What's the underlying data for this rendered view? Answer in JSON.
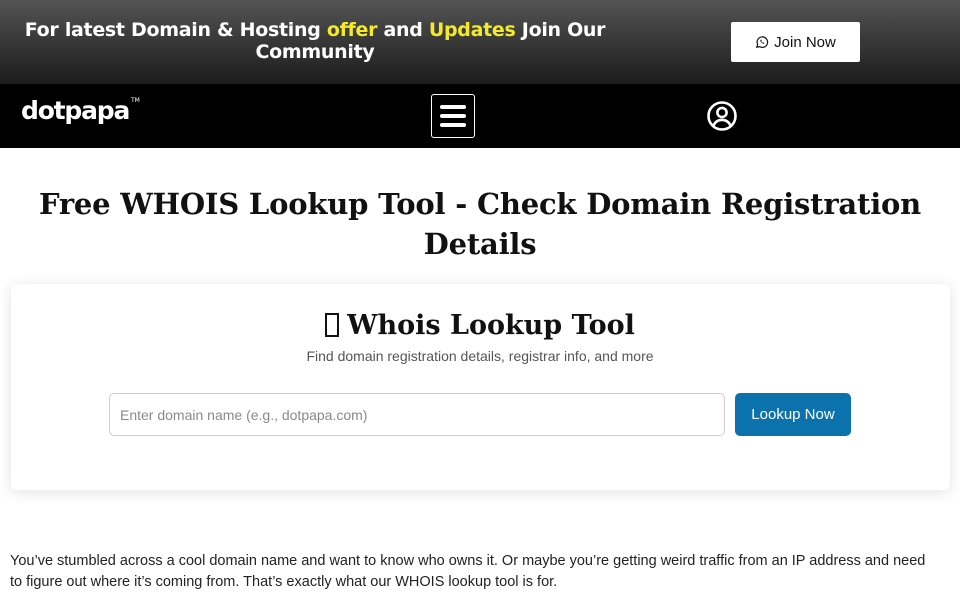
{
  "promo": {
    "text_before": "For latest Domain & Hosting ",
    "highlight_1": "offer",
    "text_middle": " and ",
    "highlight_2": "Updates",
    "text_after": " Join Our Community",
    "highlight_color": "#f5ea2a",
    "join_button": {
      "label": "Join Now",
      "icon": "whatsapp-icon"
    }
  },
  "nav": {
    "logo_text": "dotpapa",
    "logo_mark": "TM",
    "menu_icon": "hamburger-menu-icon",
    "account_icon": "user-circle-icon"
  },
  "page": {
    "title": "Free WHOIS Lookup Tool - Check Domain Registration Details"
  },
  "tool": {
    "title": "Whois Lookup Tool",
    "title_icon": "missing-glyph-icon",
    "subtitle": "Find domain registration details, registrar info, and more",
    "input": {
      "value": "",
      "placeholder": "Enter domain name (e.g., dotpapa.com)"
    },
    "button_label": "Lookup Now",
    "button_color": "#0c72ad"
  },
  "content": {
    "intro": "You’ve stumbled across a cool domain name and want to know who owns it. Or maybe you’re getting weird traffic from an IP address and need to figure out where it’s coming from. That’s exactly what our WHOIS lookup tool is for."
  }
}
